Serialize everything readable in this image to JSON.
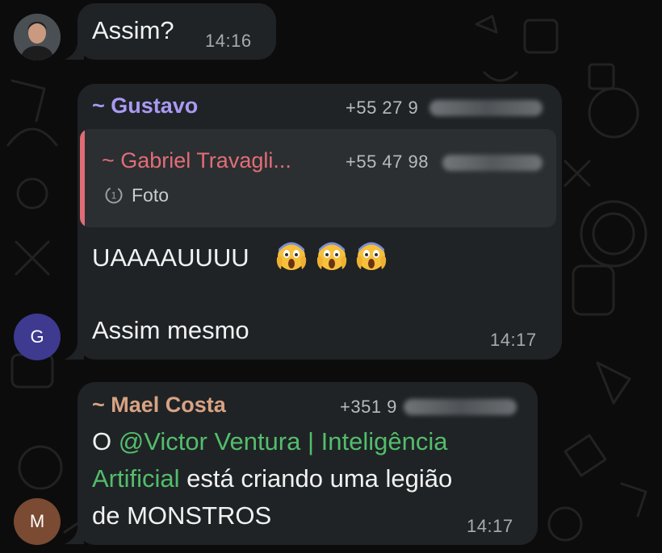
{
  "messages": [
    {
      "text": "Assim?",
      "time": "14:16"
    },
    {
      "avatar_letter": "G",
      "sender": "~ Gustavo",
      "phone": "+55 27 9",
      "reply": {
        "sender": "~ Gabriel Travagli...",
        "phone": "+55 47 98",
        "media_icon": "view-once-icon",
        "media_label": "Foto"
      },
      "line1": "UAAAAUUUU",
      "emoji": "scream-face-emoji",
      "line2": "Assim mesmo",
      "time": "14:17"
    },
    {
      "avatar_letter": "M",
      "sender": "~ Mael Costa",
      "phone": "+351 9",
      "text_prefix": "O ",
      "mention_line1": "@Victor Ventura | Inteligência",
      "mention_line2": "Artificial",
      "text_line2_rest": " está criando uma legião",
      "text_line3": "de MONSTROS",
      "time": "14:17"
    }
  ],
  "colors": {
    "gustavo": "#a99af2",
    "gabriel": "#e36d78",
    "mael": "#d9a383",
    "mention": "#53bd6b",
    "avatar_g": "#3d3a8f",
    "avatar_m": "#7a4a32"
  }
}
